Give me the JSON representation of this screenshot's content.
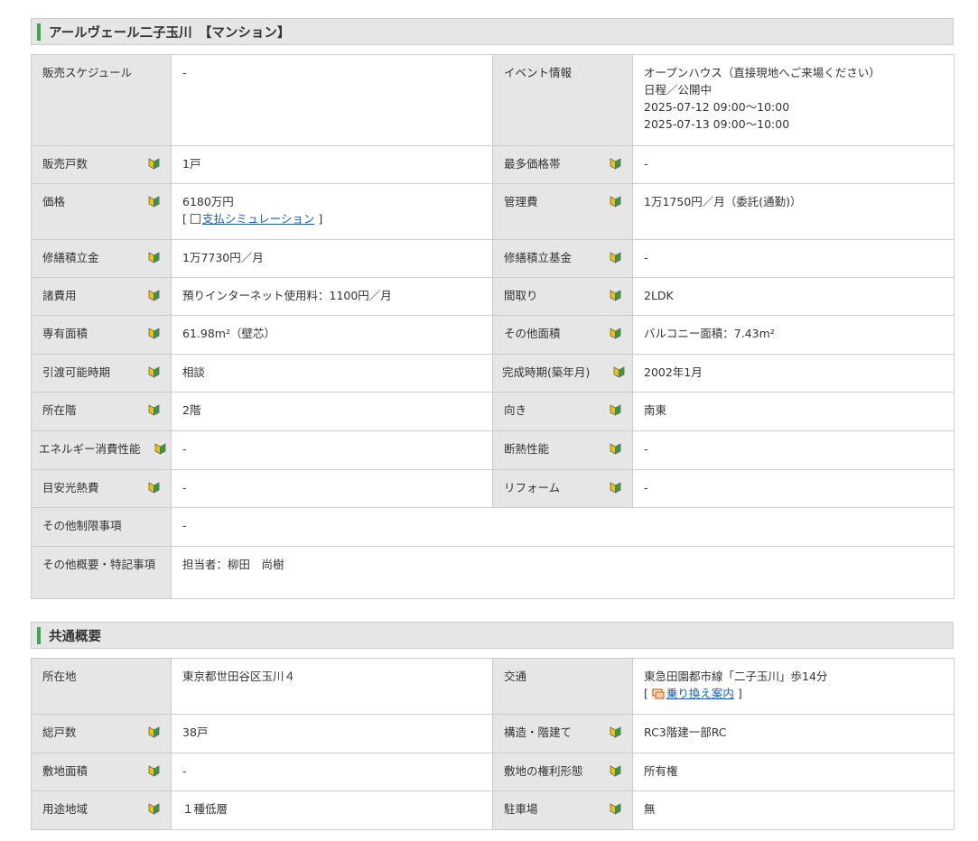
{
  "section1": {
    "title": "アールヴェール二子玉川　【マンション】",
    "rows": {
      "schedule": {
        "label": "販売スケジュール",
        "value": "-"
      },
      "event": {
        "label": "イベント情報",
        "lines": [
          "オープンハウス（直接現地へご来場ください）",
          "日程／公開中",
          "2025-07-12 09:00～10:00",
          "2025-07-13 09:00～10:00"
        ]
      },
      "units": {
        "label": "販売戸数",
        "value": "1戸"
      },
      "top_price": {
        "label": "最多価格帯",
        "value": "-"
      },
      "price": {
        "label": "価格",
        "value": "6180万円",
        "link_open": "[",
        "link_label": "支払シミュレーション",
        "link_close": "]"
      },
      "mgmt_fee": {
        "label": "管理費",
        "value": "1万1750円／月（委託(通勤)）"
      },
      "repair_reserve": {
        "label": "修繕積立金",
        "value": "1万7730円／月"
      },
      "repair_fund": {
        "label": "修繕積立基金",
        "value": "-"
      },
      "misc_fees": {
        "label": "諸費用",
        "value": "預りインターネット使用料：1100円／月"
      },
      "layout": {
        "label": "間取り",
        "value": "2LDK"
      },
      "area": {
        "label": "専有面積",
        "value": "61.98m²（壁芯）"
      },
      "other_area": {
        "label": "その他面積",
        "value": "バルコニー面積：7.43m²"
      },
      "handover": {
        "label": "引渡可能時期",
        "value": "相談"
      },
      "completion": {
        "label": "完成時期(築年月)",
        "value": "2002年1月"
      },
      "floor": {
        "label": "所在階",
        "value": "2階"
      },
      "direction": {
        "label": "向き",
        "value": "南東"
      },
      "energy": {
        "label": "エネルギー消費性能",
        "value": "-"
      },
      "insulation": {
        "label": "断熱性能",
        "value": "-"
      },
      "utility": {
        "label": "目安光熱費",
        "value": "-"
      },
      "reform": {
        "label": "リフォーム",
        "value": "-"
      },
      "restrictions": {
        "label": "その他制限事項",
        "value": "-"
      },
      "notes": {
        "label": "その他概要・特記事項",
        "value": "担当者：柳田　尚樹"
      }
    }
  },
  "section2": {
    "title": "共通概要",
    "rows": {
      "address": {
        "label": "所在地",
        "value": "東京都世田谷区玉川４"
      },
      "transport": {
        "label": "交通",
        "value": "東急田園都市線「二子玉川」歩14分",
        "link_open": "[",
        "link_label": "乗り換え案内",
        "link_close": "]"
      },
      "total_units": {
        "label": "総戸数",
        "value": "38戸"
      },
      "structure": {
        "label": "構造・階建て",
        "value": "RC3階建一部RC"
      },
      "land_area": {
        "label": "敷地面積",
        "value": "-"
      },
      "land_rights": {
        "label": "敷地の権利形態",
        "value": "所有権"
      },
      "zoning": {
        "label": "用途地域",
        "value": "１種低層"
      },
      "parking": {
        "label": "駐車場",
        "value": "無"
      }
    }
  },
  "colors": {
    "accent_green": "#3aa74a",
    "header_bg": "#e6e6e6",
    "border": "#cccccc",
    "link": "#1a5fb4"
  }
}
